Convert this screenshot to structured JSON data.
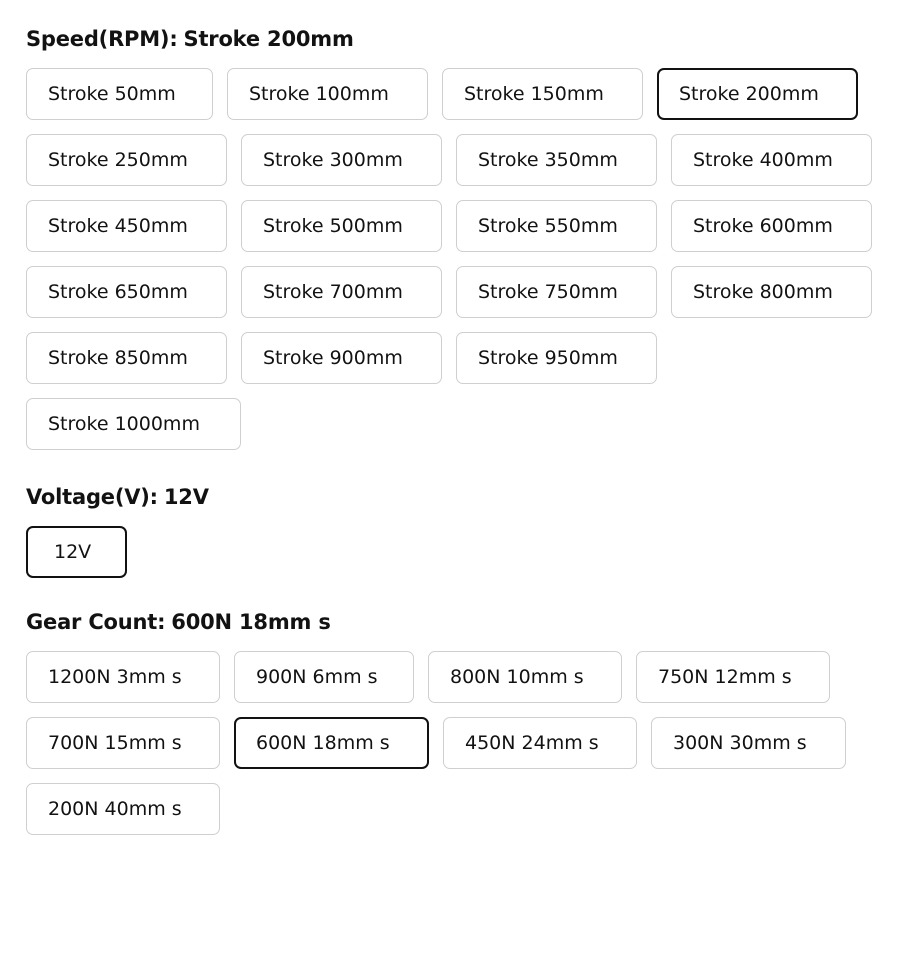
{
  "stroke": {
    "label": "Speed(RPM):",
    "selected": "Stroke 200mm",
    "options": [
      "Stroke 50mm",
      "Stroke 100mm",
      "Stroke 150mm",
      "Stroke 200mm",
      "Stroke 250mm",
      "Stroke 300mm",
      "Stroke 350mm",
      "Stroke 400mm",
      "Stroke 450mm",
      "Stroke 500mm",
      "Stroke 550mm",
      "Stroke 600mm",
      "Stroke 650mm",
      "Stroke 700mm",
      "Stroke 750mm",
      "Stroke 800mm",
      "Stroke 850mm",
      "Stroke 900mm",
      "Stroke 950mm",
      "Stroke 1000mm"
    ]
  },
  "voltage": {
    "label": "Voltage(V):",
    "selected": "12V",
    "options": [
      "12V"
    ]
  },
  "gear": {
    "label": "Gear Count:",
    "selected": "600N 18mm s",
    "options": [
      "1200N 3mm s",
      "900N 6mm s",
      "800N 10mm s",
      "750N 12mm s",
      "700N 15mm s",
      "600N 18mm s",
      "450N 24mm s",
      "300N 30mm s",
      "200N 40mm s"
    ]
  },
  "colors": {
    "text": "#121212",
    "option_border": "#cfcfcf",
    "selected_border": "#121212",
    "background": "#ffffff"
  }
}
